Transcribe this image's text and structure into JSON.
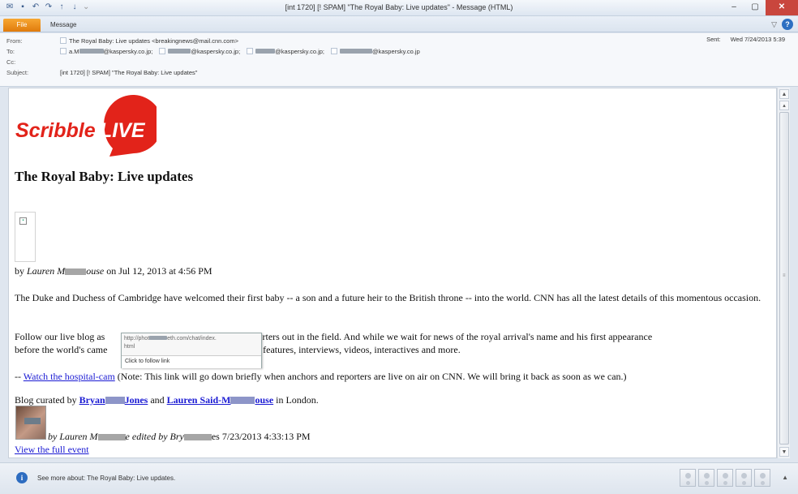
{
  "window": {
    "title": "[int 1720] [! SPAM] \"The Royal Baby: Live updates\" - Message (HTML)",
    "controls": {
      "minimize": "–",
      "maximize": "▢",
      "close": "✕"
    }
  },
  "ribbon": {
    "file_tab": "File",
    "message_tab": "Message",
    "help": "?"
  },
  "header": {
    "from_label": "From:",
    "from_value": "The Royal Baby: Live updates <breakingnews@mail.cnn.com>",
    "to_label": "To:",
    "to_suffix": "@kaspersky.co.jp;",
    "to_last_suffix": "@kaspersky.co.jp",
    "to_first_prefix": "a.M",
    "cc_label": "Cc:",
    "subject_label": "Subject:",
    "subject_value": "[int 1720] [! SPAM] \"The Royal Baby: Live updates\"",
    "sent_label": "Sent:",
    "sent_value": "Wed 7/24/2013 5:39"
  },
  "body": {
    "logo_text_1": "Scribble",
    "logo_text_2": "LIVE",
    "headline": "The Royal Baby: Live updates",
    "byline_pre": "by ",
    "byline_author_a": "Lauren M",
    "byline_author_b": "ouse",
    "byline_post": " on Jul 12, 2013 at 4:56 PM",
    "para1": "The Duke and Duchess of Cambridge have welcomed their first baby -- a son and a future heir to the British throne -- into the world. CNN has all the latest details of this momentous occasion.",
    "para2_a": "Follow our live blog as",
    "para2_b": "s CNN's reporters out in the field. And while we wait for news of the royal arrival's name and his first appearance",
    "para2_c": "before the world's came",
    "para2_d": "test features, interviews, videos, interactives and more.",
    "para3_dash": "-- ",
    "para3_link": "Watch the hospital-cam",
    "para3_rest": " (Note: This link will go down briefly when anchors and reporters are live on air on CNN. We will bring it back as soon as we can.)",
    "curated_pre": "Blog curated by ",
    "curated_link1": "Bryan",
    "curated_link1_b": "Jones",
    "curated_and": " and ",
    "curated_link2": "Lauren Said-M",
    "curated_link2_b": "ouse",
    "curated_post": " in London.",
    "edit_pre": "by Lauren M",
    "edit_mid": "e edited by Bry",
    "edit_post": "es 7/23/2013 4:33:13 PM",
    "view_full": "View the full event"
  },
  "tooltip": {
    "url_a": "http://phot",
    "url_b": "eth.com/chat/index.",
    "url_c": "html",
    "action": "Click to follow link"
  },
  "people_pane": {
    "info_icon": "i",
    "see_more": "See more about: The Royal Baby: Live updates.",
    "expand": "▲"
  },
  "colors": {
    "logo_red": "#e2231a",
    "file_tab": "#f29a1c",
    "link": "#1a1ad3"
  },
  "icons": [
    "save-icon",
    "undo-icon",
    "redo-icon",
    "up-arrow-icon",
    "down-arrow-icon",
    "info-icon",
    "help-icon"
  ]
}
